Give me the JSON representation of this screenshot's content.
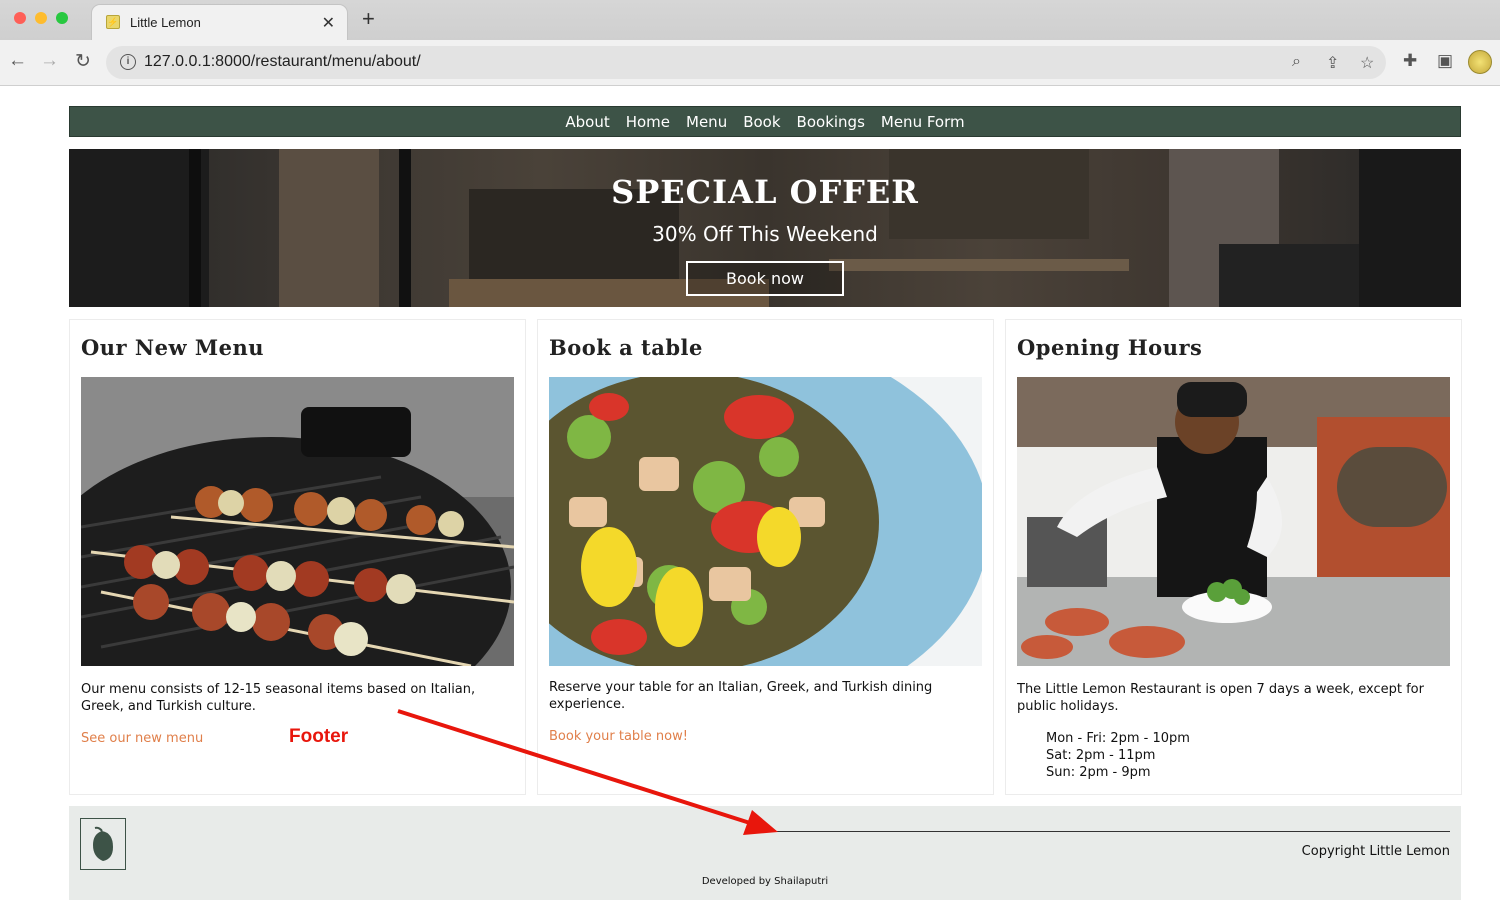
{
  "browser": {
    "tab_title": "Little Lemon",
    "url": "127.0.0.1:8000/restaurant/menu/about/"
  },
  "nav": {
    "items": [
      "About",
      "Home",
      "Menu",
      "Book",
      "Bookings",
      "Menu Form"
    ]
  },
  "hero": {
    "title": "SPECIAL OFFER",
    "subtitle": "30% Off This Weekend",
    "button": "Book now"
  },
  "cards": [
    {
      "title": "Our New Menu",
      "image": "grilled-skewers-image",
      "text": "Our menu consists of 12-15 seasonal items based on Italian, Greek, and Turkish culture.",
      "link": "See our new menu"
    },
    {
      "title": "Book a table",
      "image": "salad-plate-image",
      "text": "Reserve your table for an Italian, Greek, and Turkish dining experience.",
      "link": "Book your table now!"
    },
    {
      "title": "Opening Hours",
      "image": "chef-kitchen-image",
      "text": "The Little Lemon Restaurant is open 7 days a week, except for public holidays.",
      "hours": [
        "Mon - Fri: 2pm - 10pm",
        "Sat: 2pm - 11pm",
        "Sun: 2pm - 9pm"
      ]
    }
  ],
  "footer": {
    "copyright": "Copyright Little Lemon",
    "developed_by": "Developed by Shailaputri"
  },
  "annotation": {
    "label": "Footer",
    "color": "#e8160c"
  },
  "colors": {
    "nav_bg": "#3d5347",
    "link": "#e07f4a",
    "footer_bg": "#e8ebe9"
  }
}
